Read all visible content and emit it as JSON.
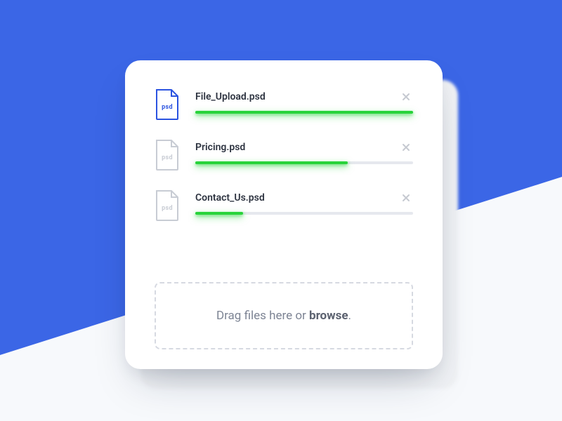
{
  "colors": {
    "accent": "#3b66e6",
    "progress": "#28d33a",
    "muted": "#c8ccd4"
  },
  "files": [
    {
      "icon_label": "psd",
      "icon_state": "active",
      "name": "File_Upload.psd",
      "progress": 100,
      "close_icon": "close-icon"
    },
    {
      "icon_label": "psd",
      "icon_state": "muted",
      "name": "Pricing.psd",
      "progress": 70,
      "close_icon": "close-icon"
    },
    {
      "icon_label": "psd",
      "icon_state": "muted",
      "name": "Contact_Us.psd",
      "progress": 22,
      "close_icon": "close-icon"
    }
  ],
  "dropzone": {
    "prefix": "Drag files here or ",
    "link": "browse",
    "suffix": "."
  }
}
